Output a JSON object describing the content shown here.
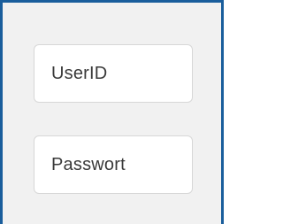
{
  "login_panel": {
    "userid_field": {
      "placeholder": "UserID"
    },
    "password_field": {
      "placeholder": "Passwort"
    }
  },
  "colors": {
    "frame_border": "#1a5e9c",
    "panel_background": "#f1f1f1",
    "field_background": "#ffffff",
    "field_border": "#d7d7d7",
    "text": "#3a3a3a"
  }
}
